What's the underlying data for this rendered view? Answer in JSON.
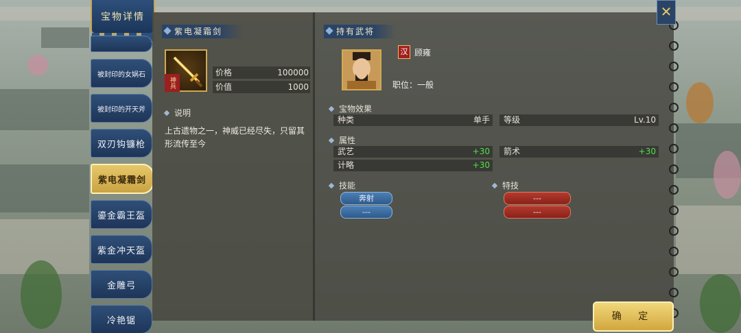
{
  "title_tab": "宝物详情",
  "side_list": [
    {
      "label": "被封印的女娲石",
      "small": true,
      "active": false
    },
    {
      "label": "被封印的开天斧",
      "small": true,
      "active": false
    },
    {
      "label": "双刃钩镰枪",
      "small": false,
      "active": false
    },
    {
      "label": "紫电凝霜剑",
      "small": false,
      "active": true
    },
    {
      "label": "鎏金霸王盔",
      "small": false,
      "active": false
    },
    {
      "label": "紫金冲天盔",
      "small": false,
      "active": false
    },
    {
      "label": "金雕弓",
      "small": false,
      "active": false
    },
    {
      "label": "冷艳锯",
      "small": false,
      "active": false
    }
  ],
  "item": {
    "name": "紫电凝霜剑",
    "badge": "神兵",
    "price_label": "价格",
    "price_value": "100000",
    "worth_label": "价值",
    "worth_value": "1000",
    "desc_label": "说明",
    "description": "上古遗物之一，神威已经尽失，只留其形流传至今"
  },
  "general": {
    "header": "持有武将",
    "faction": "汉",
    "name": "顾雍",
    "position": "职位：一般"
  },
  "effect": {
    "header": "宝物效果",
    "type_label": "种类",
    "type_value": "单手",
    "level_label": "等级",
    "level_value": "Lv.10"
  },
  "attributes": {
    "header": "属性",
    "items": [
      {
        "label": "武艺",
        "value": "+30"
      },
      {
        "label": "箭术",
        "value": "+30"
      },
      {
        "label": "计略",
        "value": "+30"
      }
    ]
  },
  "skills": {
    "header": "技能",
    "items": [
      "奔射",
      "---"
    ]
  },
  "specials": {
    "header": "特技",
    "items": [
      "---",
      "---"
    ]
  },
  "confirm_label": "确 定",
  "colors": {
    "accent_gold": "#d1aa52",
    "panel_blue": "#2b4466",
    "bonus_green": "#4fe04a"
  },
  "icons": [
    "close-icon",
    "sword-icon",
    "portrait"
  ]
}
